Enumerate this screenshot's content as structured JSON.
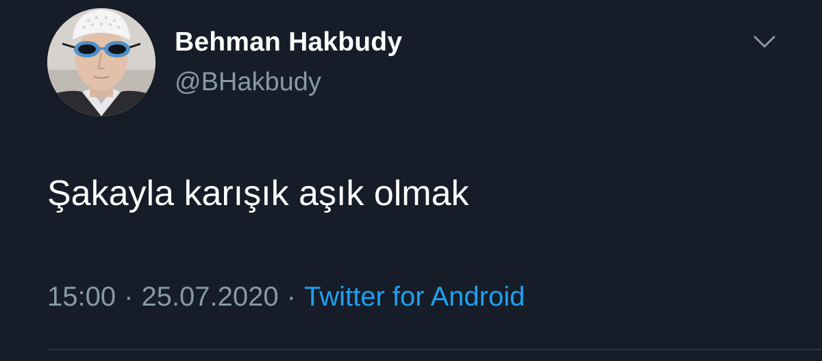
{
  "user": {
    "display_name": "Behman Hakbudy",
    "handle": "@BHakbudy",
    "avatar_icon": "profile-photo-avatar"
  },
  "menu": {
    "icon": "chevron-down-icon"
  },
  "tweet": {
    "text": "Şakayla karışık aşık olmak",
    "time": "15:00",
    "separator": "·",
    "date": "25.07.2020",
    "source": "Twitter for Android"
  },
  "colors": {
    "background": "#161d28",
    "text_primary": "#ffffff",
    "text_secondary": "#8899a6",
    "link": "#1da1f2",
    "divider": "#2a3442"
  }
}
